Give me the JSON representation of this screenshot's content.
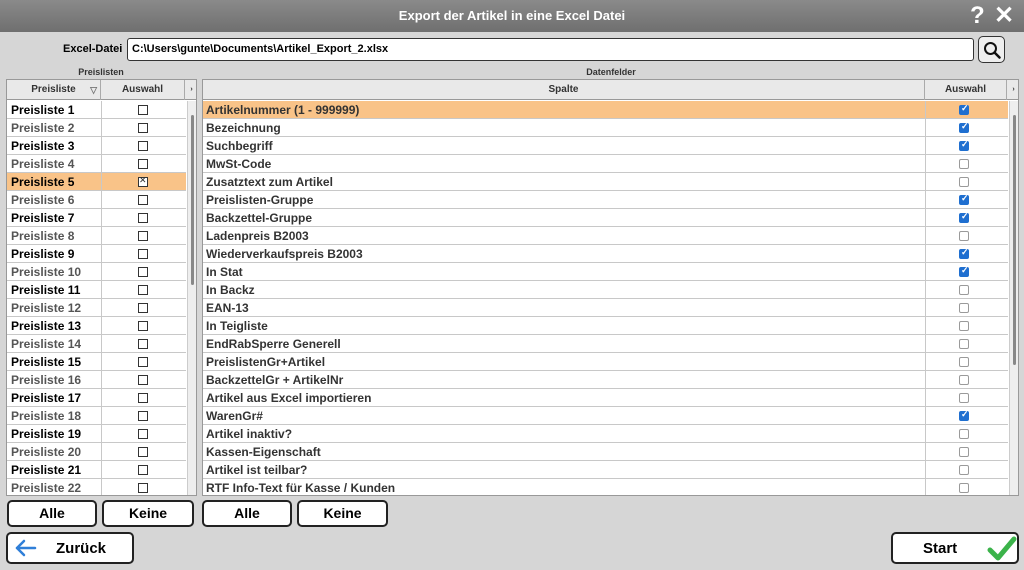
{
  "window": {
    "title": "Export der Artikel in eine Excel Datei",
    "help_icon": "?",
    "close_icon": "✕"
  },
  "file": {
    "label": "Excel-Datei",
    "value": "C:\\Users\\gunte\\Documents\\Artikel_Export_2.xlsx"
  },
  "left": {
    "section_label": "Preislisten",
    "columns": [
      "Preisliste",
      "Auswahl"
    ],
    "rows": [
      {
        "name": "Preisliste 1",
        "checked": false
      },
      {
        "name": "Preisliste 2",
        "checked": false
      },
      {
        "name": "Preisliste 3",
        "checked": false
      },
      {
        "name": "Preisliste 4",
        "checked": false
      },
      {
        "name": "Preisliste 5",
        "checked": true,
        "selected": true
      },
      {
        "name": "Preisliste 6",
        "checked": false
      },
      {
        "name": "Preisliste 7",
        "checked": false
      },
      {
        "name": "Preisliste 8",
        "checked": false
      },
      {
        "name": "Preisliste 9",
        "checked": false
      },
      {
        "name": "Preisliste 10",
        "checked": false
      },
      {
        "name": "Preisliste 11",
        "checked": false
      },
      {
        "name": "Preisliste 12",
        "checked": false
      },
      {
        "name": "Preisliste 13",
        "checked": false
      },
      {
        "name": "Preisliste 14",
        "checked": false
      },
      {
        "name": "Preisliste 15",
        "checked": false
      },
      {
        "name": "Preisliste 16",
        "checked": false
      },
      {
        "name": "Preisliste 17",
        "checked": false
      },
      {
        "name": "Preisliste 18",
        "checked": false
      },
      {
        "name": "Preisliste 19",
        "checked": false
      },
      {
        "name": "Preisliste 20",
        "checked": false
      },
      {
        "name": "Preisliste 21",
        "checked": false
      },
      {
        "name": "Preisliste 22",
        "checked": false
      }
    ],
    "all_button": "Alle",
    "none_button": "Keine"
  },
  "right": {
    "section_label": "Datenfelder",
    "columns": [
      "Spalte",
      "Auswahl"
    ],
    "rows": [
      {
        "name": "Artikelnummer (1 - 999999)",
        "checked": true,
        "selected": true
      },
      {
        "name": "Bezeichnung",
        "checked": true
      },
      {
        "name": "Suchbegriff",
        "checked": true
      },
      {
        "name": "MwSt-Code",
        "checked": false
      },
      {
        "name": "Zusatztext zum Artikel",
        "checked": false
      },
      {
        "name": "Preislisten-Gruppe",
        "checked": true
      },
      {
        "name": "Backzettel-Gruppe",
        "checked": true
      },
      {
        "name": "Ladenpreis B2003",
        "checked": false
      },
      {
        "name": "Wiederverkaufspreis B2003",
        "checked": true
      },
      {
        "name": "In Stat",
        "checked": true
      },
      {
        "name": "In Backz",
        "checked": false
      },
      {
        "name": "EAN-13",
        "checked": false
      },
      {
        "name": "In Teigliste",
        "checked": false
      },
      {
        "name": "EndRabSperre Generell",
        "checked": false
      },
      {
        "name": "PreislistenGr+Artikel",
        "checked": false
      },
      {
        "name": "BackzettelGr + ArtikelNr",
        "checked": false
      },
      {
        "name": "Artikel aus Excel importieren",
        "checked": false
      },
      {
        "name": "WarenGr#",
        "checked": true
      },
      {
        "name": "Artikel inaktiv?",
        "checked": false
      },
      {
        "name": "Kassen-Eigenschaft",
        "checked": false
      },
      {
        "name": "Artikel ist teilbar?",
        "checked": false
      },
      {
        "name": "RTF Info-Text für Kasse / Kunden",
        "checked": false
      }
    ],
    "all_button": "Alle",
    "none_button": "Keine"
  },
  "footer": {
    "back_label": "Zurück",
    "start_label": "Start"
  },
  "colors": {
    "selected_row": "#f9c388",
    "check_blue": "#1f6fd0",
    "start_check": "#3bb34a",
    "back_arrow": "#2f7fd8"
  }
}
